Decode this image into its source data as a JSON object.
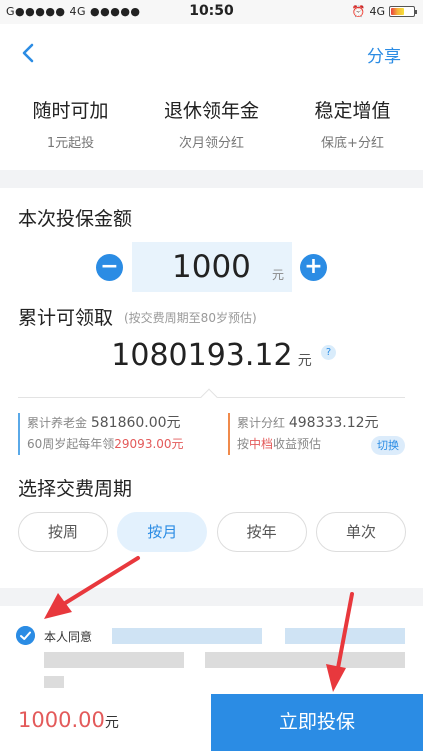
{
  "status_bar": {
    "carrier": "G●●●●● 4G ●●●●●",
    "time": "10:50",
    "network": "4G",
    "battery_level": 0.6
  },
  "nav": {
    "back_icon": "chevron-left-icon",
    "share_label": "分享"
  },
  "features": [
    {
      "title": "随时可加",
      "subtitle": "1元起投"
    },
    {
      "title": "退休领年金",
      "subtitle": "次月领分红"
    },
    {
      "title": "稳定增值",
      "subtitle": "保底+分红"
    }
  ],
  "amount": {
    "title": "本次投保金额",
    "minus": "−",
    "plus": "+",
    "value": "1000",
    "unit": "元"
  },
  "total": {
    "title": "累计可领取",
    "note": "(按交费周期至80岁预估)",
    "value": "1080193.12",
    "unit": "元",
    "help": "?"
  },
  "stats": {
    "pension_label": "累计养老金",
    "pension_value": "581860.00元",
    "yearly_prefix": "60周岁起每年领",
    "yearly_value": "29093.00元",
    "dividend_label": "累计分红",
    "dividend_value": "498333.12元",
    "estimate_prefix": "按",
    "estimate_mid": "中档",
    "estimate_suffix": "收益预估",
    "switch_label": "切换"
  },
  "period": {
    "title": "选择交费周期",
    "options": [
      "按周",
      "按月",
      "按年",
      "单次"
    ],
    "selected": "按月"
  },
  "agreement": {
    "text": "本人同意"
  },
  "footer": {
    "price": "1000.00",
    "price_unit": "元",
    "invest_label": "立即投保"
  },
  "colors": {
    "accent": "#2b8ce4",
    "price": "#e35a5a",
    "annotation": "#e8383d"
  }
}
